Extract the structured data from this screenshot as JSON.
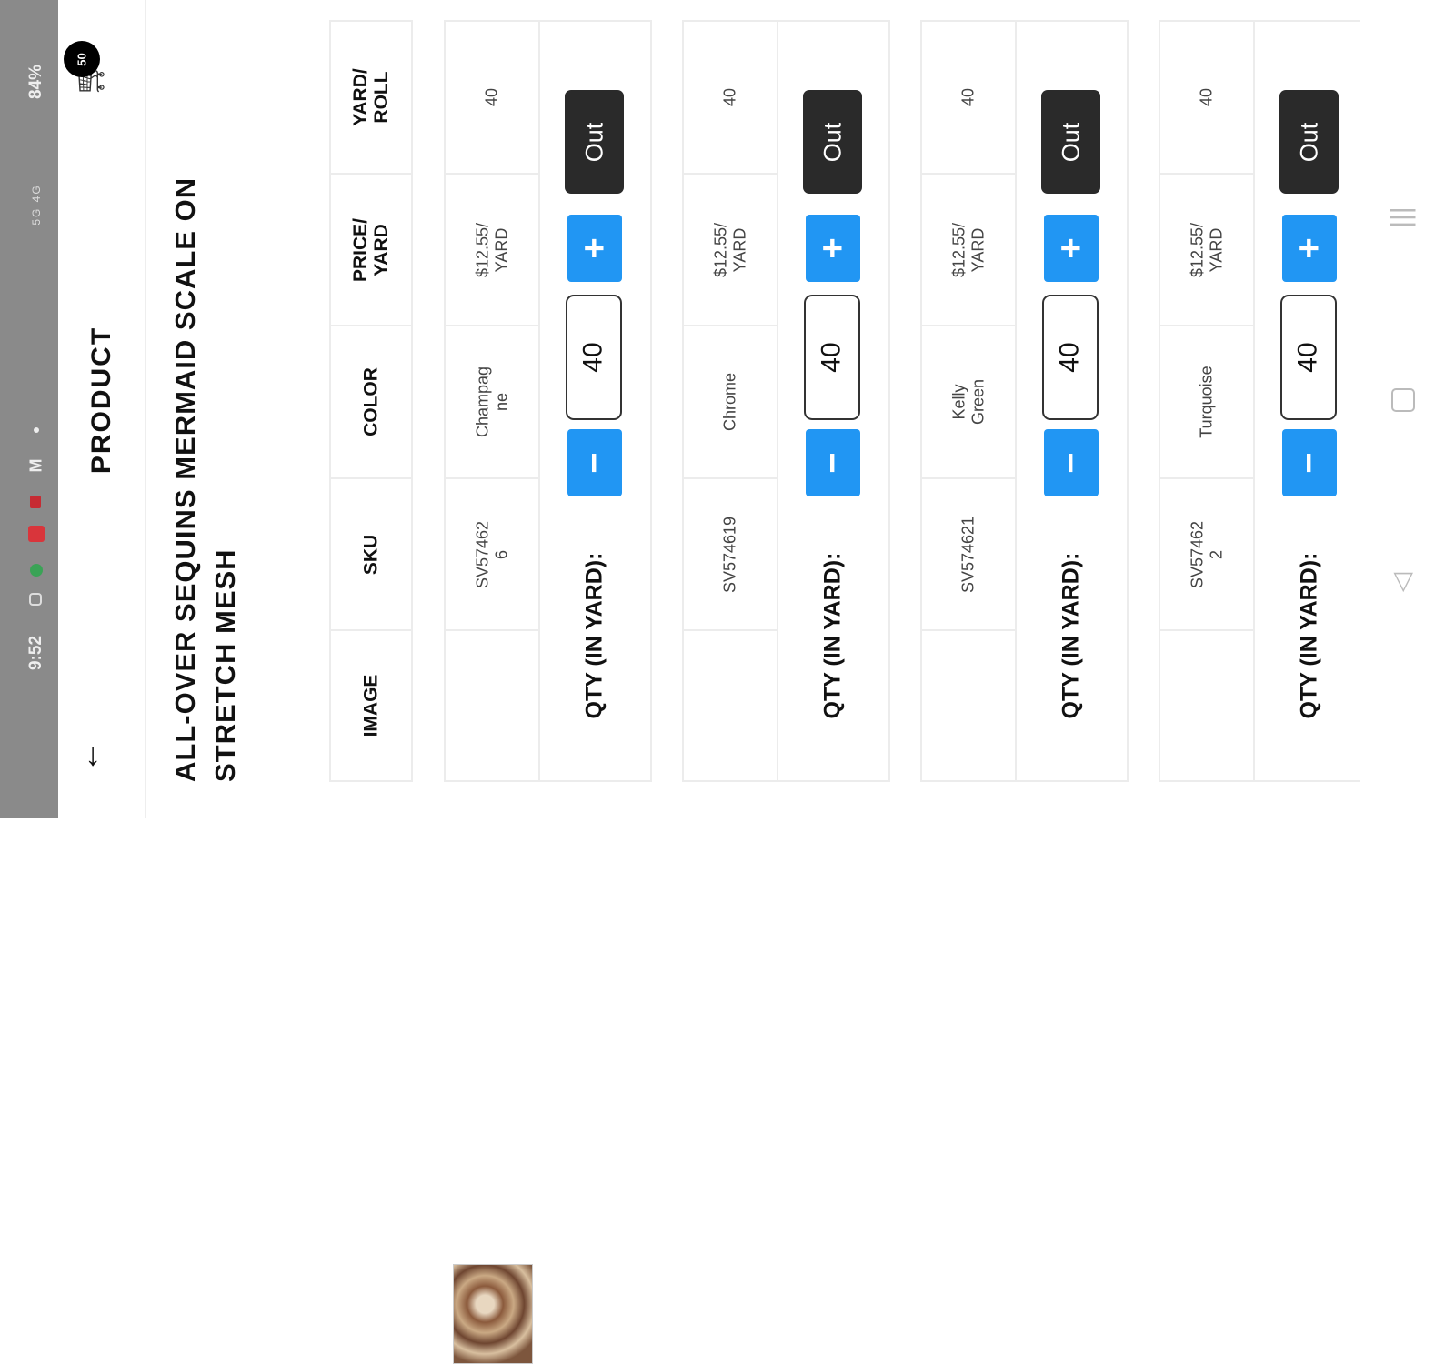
{
  "status_bar": {
    "time": "9:52",
    "battery": "84%",
    "icons": "5G 4G"
  },
  "app_bar": {
    "title": "PRODUCT",
    "cart_count": "50"
  },
  "product": {
    "title_line1": "ALL-OVER SEQUINS MERMAID SCALE ON",
    "title_line2": "STRETCH MESH"
  },
  "table": {
    "headers": {
      "image": "IMAGE",
      "sku": "SKU",
      "color": "COLOR",
      "price": "PRICE/\nYARD",
      "yard_roll": "YARD/\nROLL"
    },
    "qty_label": "QTY (IN YARD):",
    "minus_label": "−",
    "plus_label": "+",
    "out_label": "Out",
    "rows": [
      {
        "sku": "SV57462\n6",
        "color": "Champag\nne",
        "price": "$12.55/\nYARD",
        "yard_roll": "40",
        "qty": "40"
      },
      {
        "sku": "SV574619",
        "color": "Chrome",
        "price": "$12.55/\nYARD",
        "yard_roll": "40",
        "qty": "40"
      },
      {
        "sku": "SV574621",
        "color": "Kelly\nGreen",
        "price": "$12.55/\nYARD",
        "yard_roll": "40",
        "qty": "40"
      },
      {
        "sku": "SV57462\n2",
        "color": "Turquoise",
        "price": "$12.55/\nYARD",
        "yard_roll": "40",
        "qty": "40"
      }
    ]
  },
  "colors": {
    "accent_blue": "#2196f3",
    "out_button": "#2a2a2a",
    "status_bar": "#8a8a8a"
  }
}
